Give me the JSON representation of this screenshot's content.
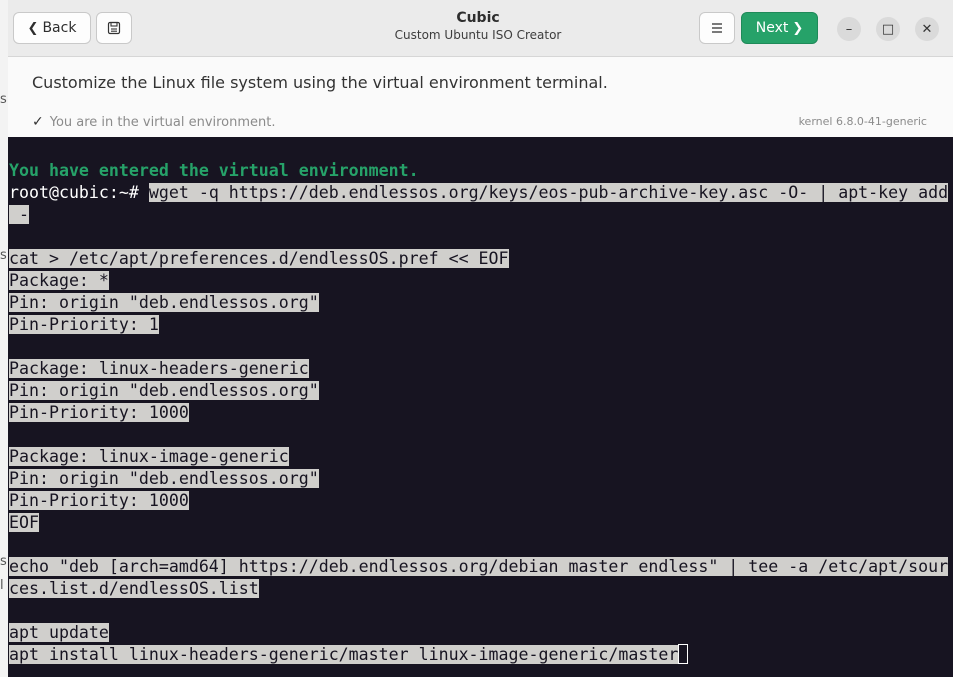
{
  "window": {
    "title": "Cubic",
    "subtitle": "Custom Ubuntu ISO Creator"
  },
  "toolbar": {
    "back_label": "Back",
    "next_label": "Next",
    "save_icon": "save-icon",
    "menu_icon": "hamburger-menu-icon"
  },
  "window_controls": {
    "minimize": "–",
    "maximize": "□",
    "close": "✕"
  },
  "page": {
    "description": "Customize the Linux file system using the virtual environment terminal.",
    "status": "You are in the virtual environment.",
    "kernel": "kernel 6.8.0-41-generic"
  },
  "desktop": {
    "chars": [
      "s",
      "s",
      "s",
      "l"
    ]
  },
  "colors": {
    "accent_green": "#26a269",
    "terminal_bg": "#171421",
    "selection_bg": "#d0cfcc"
  },
  "terminal": {
    "banner": "You have entered the virtual environment.",
    "prompt": "root@cubic:~# ",
    "lines": [
      "wget -q https://deb.endlessos.org/keys/eos-pub-archive-key.asc -O- | apt-key add",
      " -",
      "",
      "cat > /etc/apt/preferences.d/endlessOS.pref << EOF",
      "Package: *",
      "Pin: origin \"deb.endlessos.org\"",
      "Pin-Priority: 1",
      "",
      "Package: linux-headers-generic",
      "Pin: origin \"deb.endlessos.org\"",
      "Pin-Priority: 1000",
      "",
      "Package: linux-image-generic",
      "Pin: origin \"deb.endlessos.org\"",
      "Pin-Priority: 1000",
      "EOF",
      "",
      "echo \"deb [arch=amd64] https://deb.endlessos.org/debian master endless\" | tee -a /etc/apt/sour",
      "ces.list.d/endlessOS.list",
      "",
      "apt update",
      "apt install linux-headers-generic/master linux-image-generic/master"
    ]
  }
}
